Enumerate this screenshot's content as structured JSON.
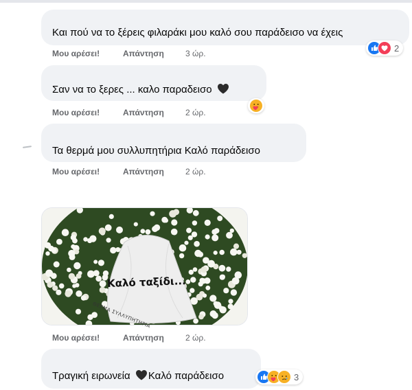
{
  "comments": [
    {
      "text": "Και πού να το ξέρεις φιλαράκι μου καλό σου παράδεισο να έχεις",
      "like_label": "Μου αρέσει!",
      "reply_label": "Απάντηση",
      "time": "3 ώρ.",
      "reactions": {
        "icons": [
          "like-icon",
          "love-icon"
        ],
        "count": "2"
      }
    },
    {
      "text": "Σαν να το ξερες ... καλο παραδεισο",
      "emoji_inline": "black-heart-icon",
      "like_label": "Μου αρέσει!",
      "reply_label": "Απάντηση",
      "time": "2 ώρ.",
      "reactions": {
        "icons": [
          "care-icon"
        ],
        "count": ""
      }
    },
    {
      "text": "Τα θερμά μου συλλυπητήρια Καλό παράδεισο",
      "like_label": "Μου αρέσει!",
      "reply_label": "Απάντηση",
      "time": "2 ώρ."
    },
    {
      "image": {
        "description_icon": "funeral-wreath-image",
        "caption": "Καλό ταξίδι...",
        "ribbon_left": "ΘΕΡΜΑ ΣΥΛΛΥΠΗΤΗΡΙΑ",
        "ribbon_right": ""
      },
      "like_label": "Μου αρέσει!",
      "reply_label": "Απάντηση",
      "time": "2 ώρ."
    },
    {
      "text": "Τραγική ειρωνεία",
      "text_after": "Καλό παράδεισο",
      "emoji_inline": "black-heart-icon",
      "reactions": {
        "icons": [
          "like-icon",
          "care-icon",
          "sad-icon"
        ],
        "count": "3"
      }
    }
  ],
  "colors": {
    "bubble": "#f0f2f5",
    "meta_text": "#65676b",
    "like_blue": "#1877f2",
    "love_red": "#f33e58",
    "care_yellow": "#f7b125"
  }
}
